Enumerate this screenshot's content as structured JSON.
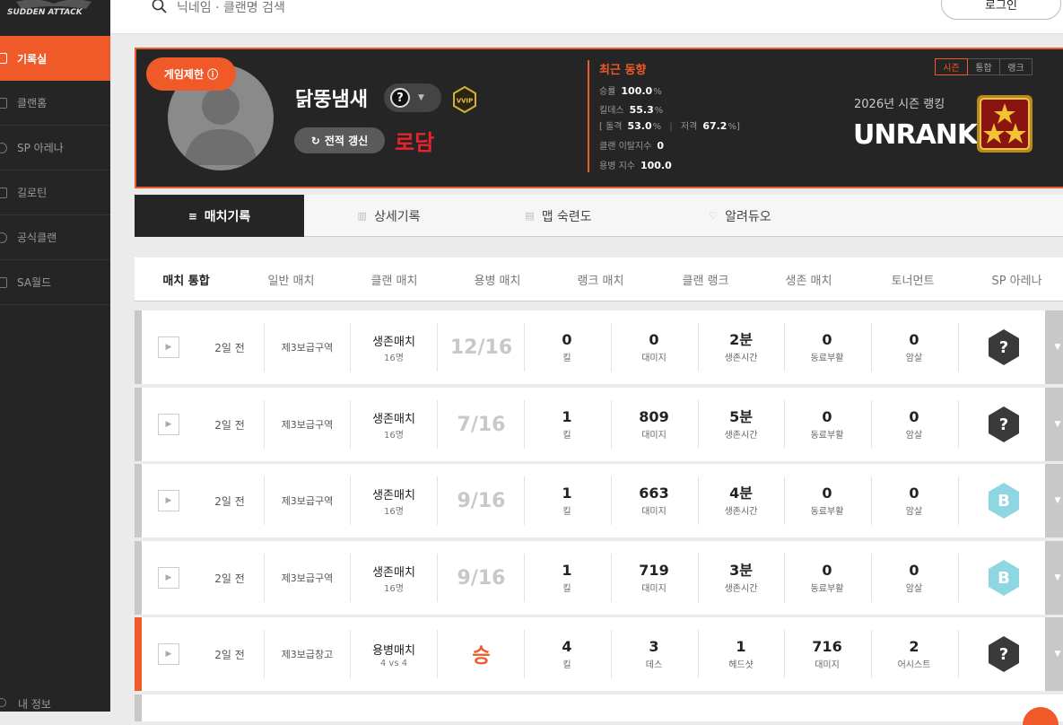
{
  "sidebar": {
    "logo_text": "SUDDEN ATTACK",
    "items": [
      {
        "label": "기록실",
        "icon": "list-icon",
        "active": true
      },
      {
        "label": "클랜홈",
        "icon": "clan-home-icon",
        "active": false
      },
      {
        "label": "SP 아레나",
        "icon": "sp-arena-icon",
        "active": false
      },
      {
        "label": "길로틴",
        "icon": "guillotine-icon",
        "active": false
      },
      {
        "label": "공식클랜",
        "icon": "official-clan-icon",
        "active": false
      },
      {
        "label": "SA월드",
        "icon": "sa-world-icon",
        "active": false
      }
    ],
    "my_info": "내 정보"
  },
  "topbar": {
    "search_placeholder": "닉네임 · 클랜명 검색",
    "login_label": "로그인"
  },
  "profile": {
    "restrict_badge": "게임제한 ⓘ",
    "nickname": "닭뚱냄새",
    "rank_symbol": "?",
    "vip_label": "VVIP",
    "refresh_label": "전적 갱신",
    "clan_tag": "로담",
    "trend": {
      "title": "최근 동향",
      "win_rate_label": "승률",
      "win_rate": "100.0",
      "pct": "%",
      "kd_label": "킬데스",
      "kd": "55.3",
      "bracket_open": "[",
      "assault_label": "돌격",
      "assault": "53.0",
      "sniper_label": "저격",
      "sniper": "67.2",
      "bracket_close": "]",
      "clan_leave_label": "클랜 이탈지수",
      "clan_leave": "0",
      "merc_label": "용병 지수",
      "merc": "100.0"
    },
    "season_tabs": [
      "시즌",
      "통합",
      "랭크"
    ],
    "season_rank_label": "2026년 시즌 랭킹",
    "season_rank_value": "UNRANK",
    "accent": "#f05a28"
  },
  "main_tabs": [
    "매치기록",
    "상세기록",
    "맵 숙련도",
    "알려듀오"
  ],
  "filter_tabs": [
    "매치 통합",
    "일반 매치",
    "클랜 매치",
    "용병 매치",
    "랭크 매치",
    "클랜 랭크",
    "생존 매치",
    "토너먼트",
    "SP 아레나"
  ],
  "matches": [
    {
      "time": "2일 전",
      "map": "제3보급구역",
      "mode": "생존매치",
      "mode_sub": "16명",
      "result": "12/16",
      "win": false,
      "stats": [
        {
          "v": "0",
          "l": "킬"
        },
        {
          "v": "0",
          "l": "대미지"
        },
        {
          "v": "2분",
          "l": "생존시간"
        },
        {
          "v": "0",
          "l": "동료부활"
        },
        {
          "v": "0",
          "l": "암살"
        }
      ],
      "emblem": "?"
    },
    {
      "time": "2일 전",
      "map": "제3보급구역",
      "mode": "생존매치",
      "mode_sub": "16명",
      "result": "7/16",
      "win": false,
      "stats": [
        {
          "v": "1",
          "l": "킬"
        },
        {
          "v": "809",
          "l": "대미지"
        },
        {
          "v": "5분",
          "l": "생존시간"
        },
        {
          "v": "0",
          "l": "동료부활"
        },
        {
          "v": "0",
          "l": "암살"
        }
      ],
      "emblem": "?"
    },
    {
      "time": "2일 전",
      "map": "제3보급구역",
      "mode": "생존매치",
      "mode_sub": "16명",
      "result": "9/16",
      "win": false,
      "stats": [
        {
          "v": "1",
          "l": "킬"
        },
        {
          "v": "663",
          "l": "대미지"
        },
        {
          "v": "4분",
          "l": "생존시간"
        },
        {
          "v": "0",
          "l": "동료부활"
        },
        {
          "v": "0",
          "l": "암살"
        }
      ],
      "emblem": "B"
    },
    {
      "time": "2일 전",
      "map": "제3보급구역",
      "mode": "생존매치",
      "mode_sub": "16명",
      "result": "9/16",
      "win": false,
      "stats": [
        {
          "v": "1",
          "l": "킬"
        },
        {
          "v": "719",
          "l": "대미지"
        },
        {
          "v": "3분",
          "l": "생존시간"
        },
        {
          "v": "0",
          "l": "동료부활"
        },
        {
          "v": "0",
          "l": "암살"
        }
      ],
      "emblem": "B"
    },
    {
      "time": "2일 전",
      "map": "제3보급창고",
      "mode": "용병매치",
      "mode_sub": "4 vs 4",
      "result": "승",
      "win": true,
      "stats": [
        {
          "v": "4",
          "l": "킬"
        },
        {
          "v": "3",
          "l": "데스"
        },
        {
          "v": "1",
          "l": "헤드샷"
        },
        {
          "v": "716",
          "l": "대미지"
        },
        {
          "v": "2",
          "l": "어시스트"
        }
      ],
      "emblem": "?"
    }
  ]
}
